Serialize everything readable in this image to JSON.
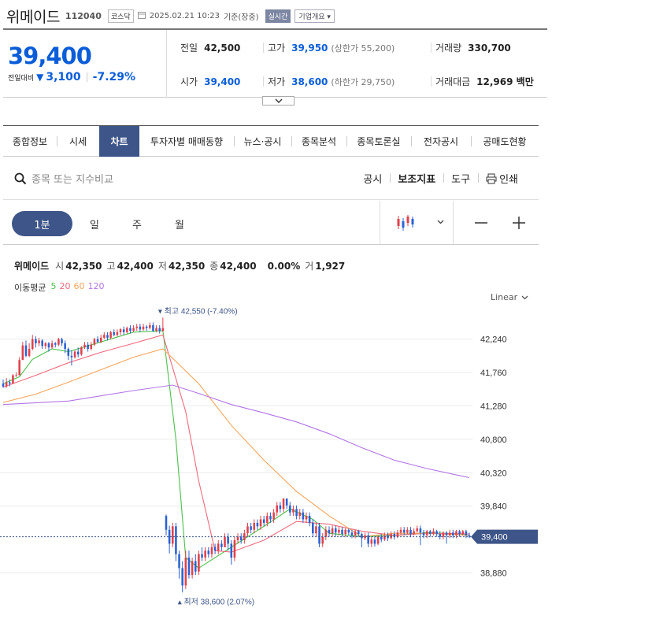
{
  "header": {
    "name": "위메이드",
    "code": "112040",
    "market": "코스닥",
    "datetime": "2025.02.21 10:23",
    "basis": "기준(장중)",
    "realtime_badge": "실시간",
    "company_button": "기업개요"
  },
  "quote": {
    "price": "39,400",
    "change_label": "전일대비",
    "change": "3,100",
    "change_pct": "-7.29%",
    "prev_label": "전일",
    "prev": "42,500",
    "high_label": "고가",
    "high": "39,950",
    "upper_limit": "(상한가 55,200)",
    "volume_label": "거래량",
    "volume": "330,700",
    "open_label": "시가",
    "open": "39,400",
    "low_label": "저가",
    "low": "38,600",
    "lower_limit": "(하한가 29,750)",
    "amount_label": "거래대금",
    "amount": "12,969",
    "amount_unit": "백만"
  },
  "tabs": [
    "종합정보",
    "시세",
    "차트",
    "투자자별 매매동향",
    "뉴스·공시",
    "종목분석",
    "종목토론실",
    "전자공시",
    "공매도현황"
  ],
  "active_tab": "차트",
  "search": {
    "placeholder": "종목 또는 지수비교"
  },
  "tools": {
    "disclosure": "공시",
    "indicators": "보조지표",
    "tool": "도구",
    "print": "인쇄"
  },
  "periods": [
    "1분",
    "일",
    "주",
    "월"
  ],
  "ohlc": {
    "name": "위메이드",
    "open_label": "시",
    "open": "42,350",
    "high_label": "고",
    "high": "42,400",
    "low_label": "저",
    "low": "42,350",
    "close_label": "종",
    "close": "42,400",
    "pct": "0.00%",
    "volume_label": "거",
    "volume": "1,927"
  },
  "ma_legend": {
    "label": "이동평균",
    "items": [
      "5",
      "20",
      "60",
      "120"
    ]
  },
  "scale": {
    "label": "Linear"
  },
  "colors": {
    "up": "#e0424a",
    "down": "#2a62d4",
    "accent": "#3d5588",
    "ma5": "#4cc04c",
    "ma20": "#f06a7c",
    "ma60": "#f5a55a",
    "ma120": "#b375e6"
  },
  "chart_data": {
    "type": "candlestick",
    "interval": "1분",
    "y_ticks": [
      42240,
      41760,
      41280,
      40800,
      40320,
      39840,
      38880
    ],
    "y_tick_labels": [
      "42,240",
      "41,760",
      "41,280",
      "40,800",
      "40,320",
      "39,840",
      "38,880"
    ],
    "ylim": [
      38400,
      42700
    ],
    "current_price": 39400,
    "current_price_label": "39,400",
    "high_annotation": "최고 42,550 (-7.40%)",
    "low_annotation": "최저 38,600 (2.07%)",
    "candles": [
      [
        41600,
        41560,
        41660,
        41540
      ],
      [
        41560,
        41620,
        41680,
        41540
      ],
      [
        41620,
        41600,
        41660,
        41560
      ],
      [
        41600,
        41720,
        41740,
        41600
      ],
      [
        41720,
        41720,
        41760,
        41700
      ],
      [
        41720,
        41940,
        41980,
        41720
      ],
      [
        41940,
        42150,
        42200,
        41940
      ],
      [
        42150,
        42000,
        42220,
        41980
      ],
      [
        42000,
        42100,
        42180,
        41980
      ],
      [
        42100,
        42240,
        42300,
        42080
      ],
      [
        42240,
        42180,
        42280,
        42120
      ],
      [
        42180,
        42220,
        42260,
        42140
      ],
      [
        42220,
        42140,
        42240,
        42100
      ],
      [
        42140,
        42180,
        42200,
        42100
      ],
      [
        42180,
        42120,
        42200,
        42060
      ],
      [
        42120,
        42180,
        42220,
        42100
      ],
      [
        42180,
        42160,
        42200,
        42120
      ],
      [
        42160,
        42240,
        42260,
        42140
      ],
      [
        42240,
        42180,
        42260,
        42140
      ],
      [
        42180,
        42100,
        42220,
        42040
      ],
      [
        42100,
        42000,
        42120,
        41940
      ],
      [
        42000,
        41980,
        42080,
        41860
      ],
      [
        41980,
        42060,
        42080,
        41960
      ],
      [
        42060,
        42020,
        42120,
        41980
      ],
      [
        42020,
        42120,
        42140,
        42000
      ],
      [
        42120,
        42160,
        42200,
        42100
      ],
      [
        42160,
        42100,
        42200,
        42060
      ],
      [
        42100,
        42160,
        42200,
        42080
      ],
      [
        42160,
        42240,
        42260,
        42140
      ],
      [
        42240,
        42200,
        42280,
        42180
      ],
      [
        42200,
        42260,
        42300,
        42180
      ],
      [
        42260,
        42300,
        42340,
        42240
      ],
      [
        42300,
        42260,
        42340,
        42220
      ],
      [
        42260,
        42340,
        42360,
        42240
      ],
      [
        42340,
        42300,
        42380,
        42280
      ],
      [
        42300,
        42340,
        42380,
        42280
      ],
      [
        42340,
        42380,
        42400,
        42300
      ],
      [
        42380,
        42340,
        42420,
        42300
      ],
      [
        42340,
        42400,
        42420,
        42320
      ],
      [
        42400,
        42360,
        42440,
        42320
      ],
      [
        42360,
        42400,
        42440,
        42340
      ],
      [
        42400,
        42420,
        42460,
        42360
      ],
      [
        42420,
        42380,
        42460,
        42340
      ],
      [
        42380,
        42420,
        42460,
        42360
      ],
      [
        42420,
        42400,
        42440,
        42360
      ],
      [
        42400,
        42440,
        42480,
        42380
      ],
      [
        42440,
        42360,
        42480,
        42340
      ],
      [
        42360,
        42400,
        42440,
        42340
      ],
      [
        42400,
        42360,
        42440,
        42320
      ],
      [
        42360,
        42400,
        42550,
        42340
      ],
      [
        39700,
        39500,
        39720,
        39420
      ],
      [
        39500,
        39300,
        39560,
        39160
      ],
      [
        39300,
        39550,
        39600,
        39250
      ],
      [
        39550,
        39150,
        39600,
        39050
      ],
      [
        39150,
        38950,
        39200,
        38800
      ],
      [
        38950,
        38700,
        39050,
        38600
      ],
      [
        38700,
        39100,
        39200,
        38650
      ],
      [
        39100,
        38850,
        39200,
        38800
      ],
      [
        38850,
        39050,
        39100,
        38800
      ],
      [
        39050,
        38900,
        39150,
        38850
      ],
      [
        38900,
        39150,
        39200,
        38850
      ],
      [
        39150,
        39100,
        39250,
        39050
      ],
      [
        39100,
        39200,
        39250,
        39050
      ],
      [
        39200,
        39150,
        39250,
        39100
      ],
      [
        39150,
        39250,
        39300,
        39100
      ],
      [
        39250,
        39200,
        39300,
        39150
      ],
      [
        39200,
        39300,
        39350,
        39150
      ],
      [
        39300,
        39250,
        39350,
        39200
      ],
      [
        39250,
        39400,
        39450,
        39250
      ],
      [
        39400,
        39300,
        39450,
        39200
      ],
      [
        39300,
        39100,
        39350,
        39000
      ],
      [
        39100,
        39350,
        39400,
        39050
      ],
      [
        39350,
        39400,
        39450,
        39300
      ],
      [
        39400,
        39350,
        39450,
        39300
      ],
      [
        39350,
        39450,
        39500,
        39300
      ],
      [
        39450,
        39550,
        39600,
        39400
      ],
      [
        39550,
        39500,
        39600,
        39450
      ],
      [
        39500,
        39600,
        39650,
        39450
      ],
      [
        39600,
        39550,
        39650,
        39500
      ],
      [
        39550,
        39650,
        39700,
        39500
      ],
      [
        39650,
        39600,
        39700,
        39550
      ],
      [
        39600,
        39700,
        39750,
        39550
      ],
      [
        39700,
        39650,
        39750,
        39600
      ],
      [
        39650,
        39750,
        39800,
        39600
      ],
      [
        39750,
        39850,
        39900,
        39700
      ],
      [
        39850,
        39800,
        39900,
        39750
      ],
      [
        39800,
        39950,
        39950,
        39750
      ],
      [
        39950,
        39850,
        39950,
        39800
      ],
      [
        39850,
        39750,
        39900,
        39700
      ],
      [
        39750,
        39800,
        39850,
        39700
      ],
      [
        39800,
        39700,
        39850,
        39650
      ],
      [
        39700,
        39750,
        39800,
        39650
      ],
      [
        39750,
        39650,
        39800,
        39600
      ],
      [
        39650,
        39700,
        39750,
        39600
      ],
      [
        39700,
        39600,
        39750,
        39550
      ],
      [
        39600,
        39450,
        39650,
        39400
      ],
      [
        39450,
        39550,
        39600,
        39400
      ],
      [
        39550,
        39300,
        39600,
        39250
      ],
      [
        39300,
        39400,
        39450,
        39250
      ],
      [
        39400,
        39500,
        39550,
        39350
      ],
      [
        39500,
        39450,
        39550,
        39400
      ],
      [
        39450,
        39520,
        39560,
        39400
      ],
      [
        39520,
        39460,
        39560,
        39400
      ],
      [
        39460,
        39500,
        39540,
        39420
      ],
      [
        39500,
        39440,
        39540,
        39400
      ],
      [
        39440,
        39500,
        39520,
        39400
      ],
      [
        39500,
        39460,
        39520,
        39420
      ],
      [
        39460,
        39420,
        39500,
        39380
      ],
      [
        39420,
        39480,
        39500,
        39380
      ],
      [
        39480,
        39440,
        39500,
        39400
      ],
      [
        39440,
        39380,
        39460,
        39250
      ],
      [
        39380,
        39420,
        39460,
        39350
      ],
      [
        39420,
        39300,
        39460,
        39250
      ],
      [
        39300,
        39360,
        39400,
        39250
      ],
      [
        39360,
        39300,
        39400,
        39260
      ],
      [
        39300,
        39400,
        39420,
        39280
      ],
      [
        39400,
        39360,
        39440,
        39320
      ],
      [
        39360,
        39420,
        39460,
        39340
      ],
      [
        39420,
        39380,
        39460,
        39340
      ],
      [
        39380,
        39440,
        39480,
        39360
      ],
      [
        39440,
        39400,
        39480,
        39360
      ],
      [
        39400,
        39460,
        39500,
        39380
      ],
      [
        39460,
        39500,
        39540,
        39420
      ],
      [
        39500,
        39460,
        39540,
        39420
      ],
      [
        39460,
        39500,
        39540,
        39440
      ],
      [
        39500,
        39440,
        39540,
        39400
      ],
      [
        39440,
        39480,
        39520,
        39420
      ],
      [
        39480,
        39520,
        39560,
        39460
      ],
      [
        39520,
        39460,
        39560,
        39280
      ],
      [
        39460,
        39420,
        39500,
        39380
      ],
      [
        39420,
        39480,
        39500,
        39380
      ],
      [
        39480,
        39440,
        39500,
        39400
      ],
      [
        39440,
        39480,
        39520,
        39420
      ],
      [
        39480,
        39440,
        39500,
        39400
      ],
      [
        39440,
        39400,
        39480,
        39360
      ],
      [
        39400,
        39460,
        39480,
        39360
      ],
      [
        39460,
        39420,
        39480,
        39300
      ],
      [
        39420,
        39460,
        39500,
        39380
      ],
      [
        39460,
        39420,
        39500,
        39380
      ],
      [
        39420,
        39480,
        39500,
        39380
      ],
      [
        39480,
        39440,
        39500,
        39400
      ],
      [
        39440,
        39480,
        39500,
        39420
      ],
      [
        39480,
        39420,
        39500,
        39380
      ],
      [
        39420,
        39400,
        39460,
        39380
      ]
    ],
    "ma": [
      {
        "name": "5",
        "points": [
          [
            0,
            41600
          ],
          [
            5,
            41700
          ],
          [
            9,
            41950
          ],
          [
            15,
            42100
          ],
          [
            20,
            42060
          ],
          [
            30,
            42200
          ],
          [
            40,
            42340
          ],
          [
            49,
            42360
          ],
          [
            53,
            40800
          ],
          [
            56,
            39100
          ],
          [
            60,
            38950
          ],
          [
            70,
            39250
          ],
          [
            80,
            39550
          ],
          [
            88,
            39800
          ],
          [
            95,
            39650
          ],
          [
            100,
            39450
          ],
          [
            110,
            39400
          ],
          [
            120,
            39420
          ],
          [
            130,
            39460
          ],
          [
            140,
            39440
          ],
          [
            143,
            39420
          ]
        ]
      },
      {
        "name": "20",
        "points": [
          [
            0,
            41550
          ],
          [
            10,
            41720
          ],
          [
            20,
            41900
          ],
          [
            30,
            42050
          ],
          [
            40,
            42180
          ],
          [
            49,
            42300
          ],
          [
            56,
            41200
          ],
          [
            60,
            40200
          ],
          [
            65,
            39200
          ],
          [
            70,
            39180
          ],
          [
            80,
            39350
          ],
          [
            90,
            39620
          ],
          [
            100,
            39580
          ],
          [
            110,
            39480
          ],
          [
            120,
            39420
          ],
          [
            130,
            39450
          ],
          [
            143,
            39440
          ]
        ]
      },
      {
        "name": "60",
        "points": [
          [
            0,
            41330
          ],
          [
            10,
            41450
          ],
          [
            20,
            41620
          ],
          [
            30,
            41800
          ],
          [
            40,
            41980
          ],
          [
            49,
            42100
          ],
          [
            60,
            41600
          ],
          [
            70,
            41000
          ],
          [
            80,
            40500
          ],
          [
            90,
            40050
          ],
          [
            100,
            39700
          ],
          [
            110,
            39400
          ],
          [
            120,
            39450
          ],
          [
            130,
            39450
          ],
          [
            143,
            39420
          ]
        ]
      },
      {
        "name": "120",
        "points": [
          [
            0,
            41300
          ],
          [
            20,
            41350
          ],
          [
            40,
            41500
          ],
          [
            52,
            41580
          ],
          [
            60,
            41460
          ],
          [
            70,
            41300
          ],
          [
            80,
            41180
          ],
          [
            90,
            41050
          ],
          [
            100,
            40880
          ],
          [
            110,
            40680
          ],
          [
            120,
            40500
          ],
          [
            130,
            40380
          ],
          [
            140,
            40280
          ],
          [
            143,
            40250
          ]
        ]
      }
    ]
  }
}
